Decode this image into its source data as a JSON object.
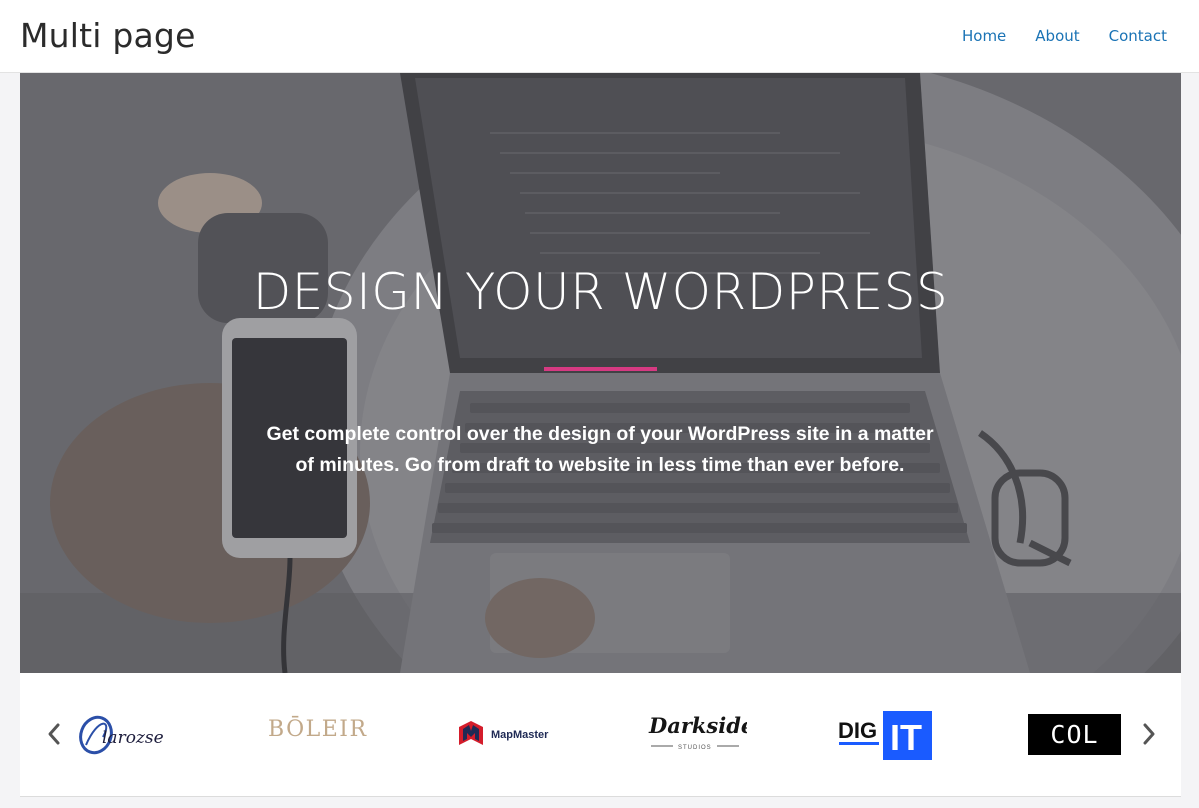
{
  "header": {
    "site_title": "Multi page",
    "nav": [
      {
        "label": "Home"
      },
      {
        "label": "About"
      },
      {
        "label": "Contact"
      }
    ]
  },
  "hero": {
    "title": "DESIGN YOUR WORDPRESS",
    "text_line1": "Get complete control over the design of your WordPress site in a matter",
    "text_line2": "of minutes. Go from draft to website in less time than ever before."
  },
  "logos": {
    "items": [
      {
        "name": "clarozse",
        "text": "larozse"
      },
      {
        "name": "boleir",
        "text": "BŌLEIR"
      },
      {
        "name": "mapmaster",
        "text": "MapMaster"
      },
      {
        "name": "darkside",
        "text": "Darkside",
        "sub": "STUDIOS"
      },
      {
        "name": "digit",
        "text_a": "DIG",
        "text_b": "IT"
      },
      {
        "name": "col",
        "text": "COL"
      }
    ]
  },
  "colors": {
    "accent": "#d63a82",
    "link": "#1a73b5",
    "digit_blue": "#1a5bff"
  },
  "icons": {
    "prev": "chevron-left-icon",
    "next": "chevron-right-icon"
  }
}
